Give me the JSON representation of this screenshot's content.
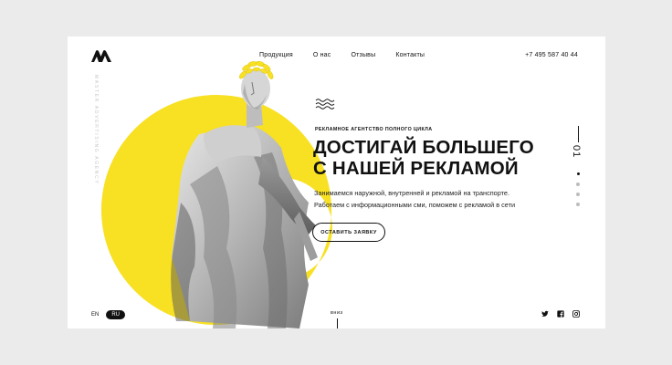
{
  "header": {
    "nav": [
      "Продукция",
      "О нас",
      "Отзывы",
      "Контакты"
    ],
    "phone": "+7 495 587 40 44"
  },
  "sidebar": {
    "vertical_text": "MASTER ADVERTISING AGENCY"
  },
  "hero": {
    "eyebrow": "РЕКЛАМНОЕ АГЕНТСТВО ПОЛНОГО ЦИКЛА",
    "headline_line1": "ДОСТИГАЙ БОЛЬШЕГО",
    "headline_line2": "С НАШЕЙ РЕКЛАМОЙ",
    "sub_line1": "Занимаемся наружной, внутренней и рекламой на транспорте.",
    "sub_line2": "Работаем с информационными сми, поможем с рекламой в сети",
    "cta_label": "ОСТАВИТЬ ЗАЯВКУ"
  },
  "slider": {
    "current": "01",
    "total_dots": 4,
    "active_index": 0
  },
  "footer": {
    "languages": [
      "EN",
      "RU"
    ],
    "active_language": "RU",
    "scroll_label": "вниз",
    "social_icons": [
      "twitter-icon",
      "facebook-icon",
      "instagram-icon"
    ]
  },
  "colors": {
    "accent": "#f8e022",
    "text": "#111111",
    "background": "#ebebeb",
    "card": "#ffffff"
  }
}
